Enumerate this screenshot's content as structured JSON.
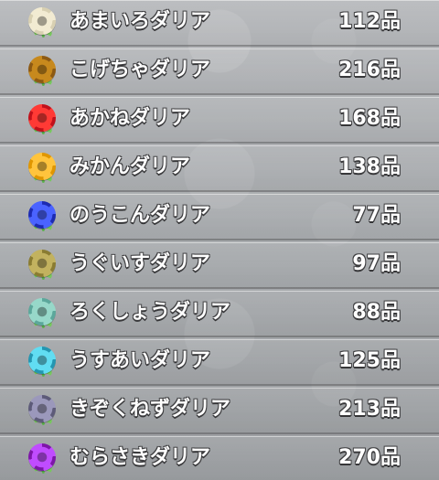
{
  "items": [
    {
      "name": "あまいろダリア",
      "count": "112品",
      "icon": "dahlia-flower-icon",
      "colors": {
        "petal": "#d8d0b2",
        "petal2": "#f2ebd2"
      }
    },
    {
      "name": "こげちゃダリア",
      "count": "216品",
      "icon": "dahlia-flower-icon",
      "colors": {
        "petal": "#8d5a13",
        "petal2": "#c7891d"
      }
    },
    {
      "name": "あかねダリア",
      "count": "168品",
      "icon": "dahlia-flower-icon",
      "colors": {
        "petal": "#c1111b",
        "petal2": "#ff3a35"
      }
    },
    {
      "name": "みかんダリア",
      "count": "138品",
      "icon": "dahlia-flower-icon",
      "colors": {
        "petal": "#e09600",
        "petal2": "#ffc43d"
      }
    },
    {
      "name": "のうこんダリア",
      "count": "77品",
      "icon": "dahlia-flower-icon",
      "colors": {
        "petal": "#1d2bb2",
        "petal2": "#4a63ff"
      }
    },
    {
      "name": "うぐいすダリア",
      "count": "97品",
      "icon": "dahlia-flower-icon",
      "colors": {
        "petal": "#8a7c32",
        "petal2": "#c2b25f"
      }
    },
    {
      "name": "ろくしょうダリア",
      "count": "88品",
      "icon": "dahlia-flower-icon",
      "colors": {
        "petal": "#5ca79b",
        "petal2": "#97d8c9"
      }
    },
    {
      "name": "うすあいダリア",
      "count": "125品",
      "icon": "dahlia-flower-icon",
      "colors": {
        "petal": "#2496b1",
        "petal2": "#61ddf2"
      }
    },
    {
      "name": "きぞくねずダリア",
      "count": "213品",
      "icon": "dahlia-flower-icon",
      "colors": {
        "petal": "#5d5b79",
        "petal2": "#9b98bb"
      }
    },
    {
      "name": "むらさきダリア",
      "count": "270品",
      "icon": "dahlia-flower-icon",
      "colors": {
        "petal": "#7d16a8",
        "petal2": "#c04cff"
      }
    }
  ]
}
